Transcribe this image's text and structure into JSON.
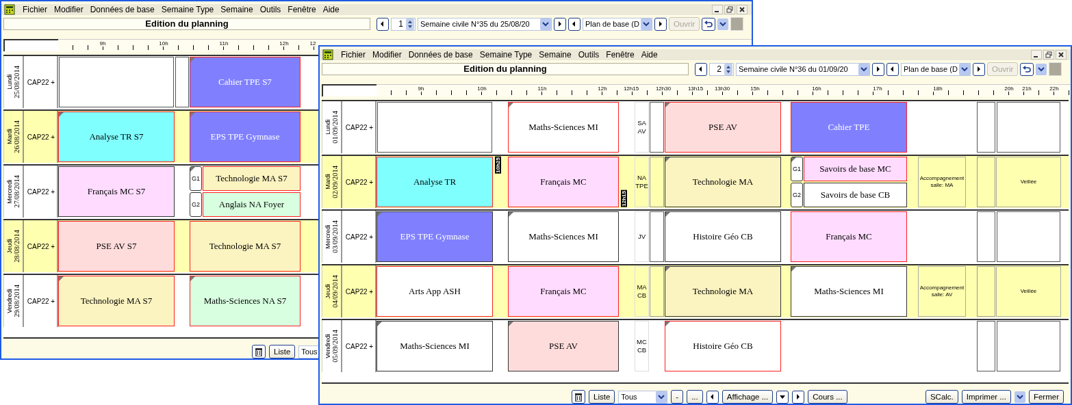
{
  "windows": [
    {
      "menu": [
        "Fichier",
        "Modifier",
        "Données de base",
        "Semaine Type",
        "Semaine",
        "Outils",
        "Fenêtre",
        "Aide"
      ],
      "title": "Edition du planning",
      "toolbar": [
        {
          "kind": "prev"
        },
        {
          "kind": "spin",
          "value": "1"
        },
        {
          "kind": "select",
          "value": "Semaine civile N°35 du 25/08/20"
        },
        {
          "kind": "next"
        },
        {
          "kind": "prev"
        },
        {
          "kind": "select",
          "value": "Plan de base (D"
        },
        {
          "kind": "next"
        },
        {
          "kind": "button",
          "label": "Ouvrir",
          "disabled": true
        },
        {
          "kind": "undo"
        },
        {
          "kind": "dropdown"
        },
        {
          "kind": "swatch"
        }
      ],
      "ruler": [
        "9h",
        "10h",
        "11h",
        "12h",
        "12"
      ],
      "days": [
        {
          "name": "Lundi",
          "date": "25/08/2014",
          "class": "CAP22 +",
          "shaded": false,
          "slots": [
            {
              "kind": "box"
            },
            {
              "kind": "box"
            },
            {
              "kind": "course",
              "title": "Cahier TPE S7",
              "color": "#8080ff",
              "outlined": true,
              "corner": true
            },
            {
              "kind": "blank"
            }
          ]
        },
        {
          "name": "Mardi",
          "date": "26/08/2014",
          "class": "CAP22 +",
          "shaded": true,
          "slots": [
            {
              "kind": "course",
              "title": "Analyse TR S7",
              "color": "#80ffff",
              "outlined": true,
              "corner": true
            },
            {
              "kind": "blank"
            },
            {
              "kind": "course",
              "title": "EPS TPE Gymnase",
              "color": "#8080ff",
              "outlined": true,
              "corner": true
            },
            {
              "kind": "blank"
            }
          ]
        },
        {
          "name": "Mercredi",
          "date": "27/08/2014",
          "class": "CAP22 +",
          "shaded": false,
          "slots": [
            {
              "kind": "course",
              "title": "Français MC S7",
              "color": "#ffdcff",
              "outlined": false,
              "corner": false
            },
            {
              "kind": "blank"
            },
            {
              "kind": "split",
              "groups": [
                {
                  "label": "G1",
                  "title": "Technologie MA S7",
                  "color": "#fbf3c0",
                  "outlined": true,
                  "corner": true
                },
                {
                  "label": "G2",
                  "title": "Anglais NA Foyer",
                  "color": "#d8ffe0",
                  "outlined": true,
                  "corner": false
                }
              ]
            },
            {
              "kind": "blank"
            }
          ]
        },
        {
          "name": "Jeudi",
          "date": "28/08/2014",
          "class": "CAP22 +",
          "shaded": true,
          "slots": [
            {
              "kind": "course",
              "title": "PSE AV S7",
              "color": "#ffdcdc",
              "outlined": true,
              "corner": false
            },
            {
              "kind": "blank"
            },
            {
              "kind": "course",
              "title": "Technologie MA S7",
              "color": "#fbf3c0",
              "outlined": true,
              "corner": false
            },
            {
              "kind": "blank"
            }
          ]
        },
        {
          "name": "Vendredi",
          "date": "29/08/2014",
          "class": "CAP22 +",
          "shaded": false,
          "slots": [
            {
              "kind": "course",
              "title": "Technologie MA S7",
              "color": "#fbf3c0",
              "outlined": true,
              "corner": true
            },
            {
              "kind": "blank"
            },
            {
              "kind": "course",
              "title": "Maths-Sciences NA S7",
              "color": "#d8ffe0",
              "outlined": true,
              "corner": true
            },
            {
              "kind": "blank"
            }
          ]
        }
      ],
      "bottom_left": [
        {
          "kind": "trash"
        },
        {
          "kind": "button",
          "label": "Liste"
        },
        {
          "kind": "select",
          "value": "Tous"
        }
      ]
    },
    {
      "menu": [
        "Fichier",
        "Modifier",
        "Données de base",
        "Semaine Type",
        "Semaine",
        "Outils",
        "Fenêtre",
        "Aide"
      ],
      "title": "Edition du planning",
      "toolbar": [
        {
          "kind": "prev"
        },
        {
          "kind": "spin",
          "value": "2"
        },
        {
          "kind": "select",
          "value": "Semaine civile N°36 du 01/09/20"
        },
        {
          "kind": "next"
        },
        {
          "kind": "prev"
        },
        {
          "kind": "select",
          "value": "Plan de base (D"
        },
        {
          "kind": "next"
        },
        {
          "kind": "button",
          "label": "Ouvrir",
          "disabled": true
        },
        {
          "kind": "undo"
        },
        {
          "kind": "dropdown"
        },
        {
          "kind": "swatch"
        }
      ],
      "ruler": [
        "9h",
        "10h",
        "11h",
        "12h",
        "12h15",
        "12h30",
        "13h15",
        "13h30",
        "15h",
        "16h",
        "17h",
        "18h",
        "20h",
        "21h",
        "22h"
      ],
      "days": [
        {
          "name": "Lundi",
          "date": "01/09/2014",
          "class": "CAP22 +",
          "shaded": false,
          "slots": [
            {
              "kind": "box"
            },
            {
              "kind": "blank"
            },
            {
              "kind": "course",
              "title": "Maths-Sciences MI",
              "color": "#ffffff",
              "outlined": true,
              "corner": true
            },
            {
              "kind": "blank"
            },
            {
              "kind": "note",
              "text": "SA AV"
            },
            {
              "kind": "box"
            },
            {
              "kind": "course",
              "title": "PSE AV",
              "color": "#ffdcdc",
              "outlined": true,
              "corner": true
            },
            {
              "kind": "blank"
            },
            {
              "kind": "course",
              "title": "Cahier TPE",
              "color": "#8080ff",
              "outlined": true,
              "corner": false
            },
            {
              "kind": "blank"
            },
            {
              "kind": "blank"
            },
            {
              "kind": "blank"
            },
            {
              "kind": "box"
            },
            {
              "kind": "box"
            }
          ]
        },
        {
          "name": "Mardi",
          "date": "02/09/2014",
          "class": "CAP22 +",
          "shaded": true,
          "slots": [
            {
              "kind": "course",
              "title": "Analyse TR",
              "color": "#80ffff",
              "outlined": true,
              "corner": false
            },
            {
              "kind": "blank",
              "tag": {
                "text": "10h25",
                "kind": "start"
              }
            },
            {
              "kind": "course",
              "title": "Français MC",
              "color": "#ffdcff",
              "outlined": true,
              "corner": false
            },
            {
              "kind": "blank",
              "tag": {
                "text": "12h15",
                "kind": "end"
              }
            },
            {
              "kind": "note",
              "text": "NA TPE"
            },
            {
              "kind": "box"
            },
            {
              "kind": "course",
              "title": "Technologie MA",
              "color": "#fbf3c0",
              "outlined": false,
              "corner": true
            },
            {
              "kind": "blank"
            },
            {
              "kind": "split",
              "groups": [
                {
                  "label": "G1",
                  "title": "Savoirs de base MC",
                  "color": "#ffdcff",
                  "outlined": true,
                  "corner": true
                },
                {
                  "label": "G2",
                  "title": "Savoirs de base CB",
                  "color": "#ffffff",
                  "outlined": false,
                  "corner": false
                }
              ]
            },
            {
              "kind": "blank"
            },
            {
              "kind": "activity",
              "text": "Accompagnement salle: MA"
            },
            {
              "kind": "blank"
            },
            {
              "kind": "box"
            },
            {
              "kind": "activity",
              "text": "Veillée"
            }
          ]
        },
        {
          "name": "Mercredi",
          "date": "03/09/2014",
          "class": "CAP22 +",
          "shaded": false,
          "slots": [
            {
              "kind": "course",
              "title": "EPS TPE Gymnase",
              "color": "#8080ff",
              "outlined": false,
              "corner": true
            },
            {
              "kind": "blank"
            },
            {
              "kind": "course",
              "title": "Maths-Sciences MI",
              "color": "#ffffff",
              "outlined": false,
              "corner": true
            },
            {
              "kind": "blank"
            },
            {
              "kind": "note",
              "text": "JV"
            },
            {
              "kind": "box"
            },
            {
              "kind": "course",
              "title": "Histoire Géo CB",
              "color": "#ffffff",
              "outlined": false,
              "corner": true
            },
            {
              "kind": "blank"
            },
            {
              "kind": "course",
              "title": "Français MC",
              "color": "#ffdcff",
              "outlined": true,
              "corner": false
            },
            {
              "kind": "blank"
            },
            {
              "kind": "blank"
            },
            {
              "kind": "blank"
            },
            {
              "kind": "box"
            },
            {
              "kind": "box"
            }
          ]
        },
        {
          "name": "Jeudi",
          "date": "04/09/2014",
          "class": "CAP22 +",
          "shaded": true,
          "slots": [
            {
              "kind": "course",
              "title": "Arts App ASH",
              "color": "#ffffff",
              "outlined": true,
              "corner": false
            },
            {
              "kind": "blank"
            },
            {
              "kind": "course",
              "title": "Français MC",
              "color": "#ffdcff",
              "outlined": true,
              "corner": false
            },
            {
              "kind": "blank"
            },
            {
              "kind": "note",
              "text": "MA CB"
            },
            {
              "kind": "box"
            },
            {
              "kind": "course",
              "title": "Technologie MA",
              "color": "#fbf3c0",
              "outlined": false,
              "corner": true
            },
            {
              "kind": "blank"
            },
            {
              "kind": "course",
              "title": "Maths-Sciences MI",
              "color": "#ffffff",
              "outlined": false,
              "corner": true
            },
            {
              "kind": "blank"
            },
            {
              "kind": "activity",
              "text": "Accompagnement salle: AV"
            },
            {
              "kind": "blank"
            },
            {
              "kind": "box"
            },
            {
              "kind": "activity",
              "text": "Veillée"
            }
          ]
        },
        {
          "name": "Vendredi",
          "date": "05/09/2014",
          "class": "CAP22 +",
          "shaded": false,
          "slots": [
            {
              "kind": "course",
              "title": "Maths-Sciences MI",
              "color": "#ffffff",
              "outlined": false,
              "corner": true
            },
            {
              "kind": "blank"
            },
            {
              "kind": "course",
              "title": "PSE AV",
              "color": "#ffdcdc",
              "outlined": false,
              "corner": true
            },
            {
              "kind": "blank"
            },
            {
              "kind": "note",
              "text": "MC CB"
            },
            {
              "kind": "blank"
            },
            {
              "kind": "course",
              "title": "Histoire Géo CB",
              "color": "#ffffff",
              "outlined": true,
              "corner": true
            },
            {
              "kind": "blank"
            },
            {
              "kind": "blank"
            },
            {
              "kind": "blank"
            },
            {
              "kind": "blank"
            },
            {
              "kind": "blank"
            },
            {
              "kind": "box"
            },
            {
              "kind": "box"
            }
          ]
        }
      ],
      "bottom_left": [
        {
          "kind": "trash"
        },
        {
          "kind": "button",
          "label": "Liste"
        },
        {
          "kind": "select",
          "value": "Tous"
        },
        {
          "kind": "button",
          "label": "-"
        },
        {
          "kind": "button",
          "label": "..."
        },
        {
          "kind": "prev"
        },
        {
          "kind": "button",
          "label": "Affichage ..."
        },
        {
          "kind": "down"
        },
        {
          "kind": "next"
        },
        {
          "kind": "button",
          "label": "Cours ..."
        }
      ],
      "bottom_right": [
        {
          "kind": "button",
          "label": "SCalc."
        },
        {
          "kind": "button",
          "label": "Imprimer ..."
        },
        {
          "kind": "dropdown"
        },
        {
          "kind": "button",
          "label": "Fermer"
        }
      ]
    }
  ]
}
